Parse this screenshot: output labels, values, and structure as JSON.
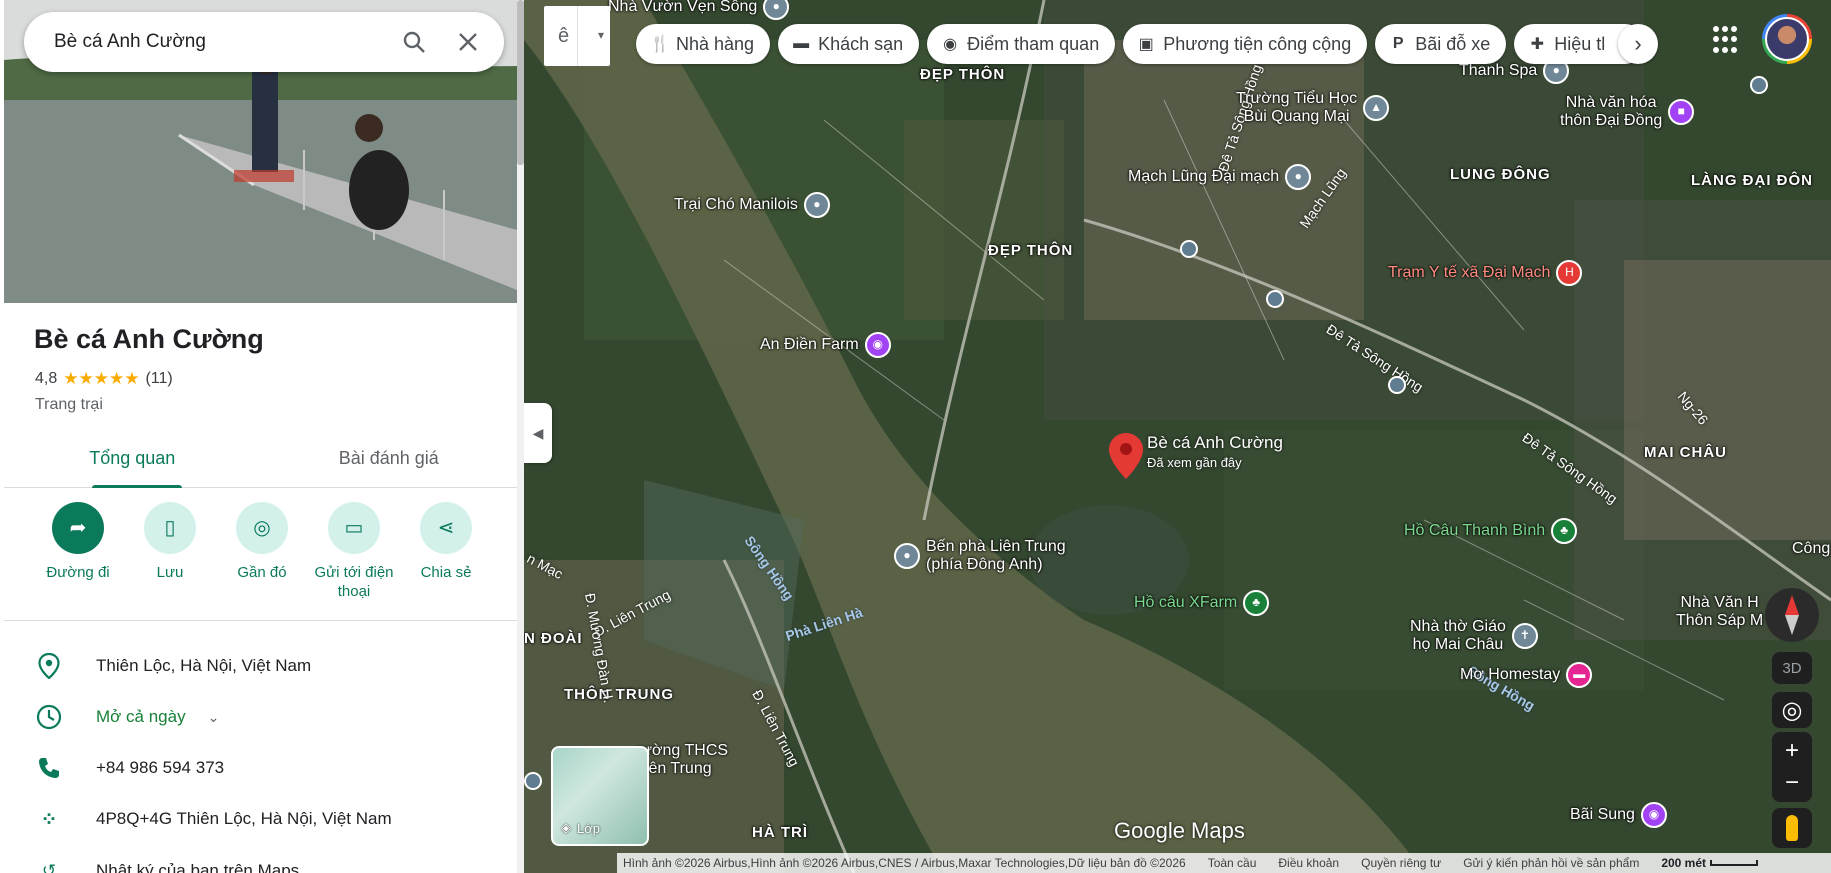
{
  "search": {
    "query": "Bè cá Anh Cường"
  },
  "place": {
    "name": "Bè cá Anh Cường",
    "rating": "4,8",
    "stars": "★★★★★",
    "review_count": "(11)",
    "category": "Trang trại"
  },
  "tabs": [
    {
      "label": "Tổng quan",
      "active": true
    },
    {
      "label": "Bài đánh giá",
      "active": false
    }
  ],
  "actions": [
    {
      "label": "Đường đi",
      "icon": "directions-icon"
    },
    {
      "label": "Lưu",
      "icon": "bookmark-icon"
    },
    {
      "label": "Gần đó",
      "icon": "nearby-icon"
    },
    {
      "label": "Gửi tới điện thoại",
      "icon": "send-to-phone-icon"
    },
    {
      "label": "Chia sẻ",
      "icon": "share-icon"
    }
  ],
  "info": {
    "address": "Thiên Lộc, Hà Nội, Việt Nam",
    "hours": "Mở cả ngày",
    "phone": "+84 986 594 373",
    "plus_code": "4P8Q+4G Thiên Lộc, Hà Nội, Việt Nam",
    "history": "Nhật ký của bạn trên Maps"
  },
  "top_bar": {
    "lang_button": "ê",
    "chips": [
      {
        "label": "Nhà hàng",
        "icon": "restaurant-icon"
      },
      {
        "label": "Khách sạn",
        "icon": "hotel-icon"
      },
      {
        "label": "Điểm tham quan",
        "icon": "camera-icon"
      },
      {
        "label": "Phương tiện công cộng",
        "icon": "transit-icon"
      },
      {
        "label": "Bãi đỗ xe",
        "icon": "parking-icon"
      },
      {
        "label": "Hiệu tl",
        "icon": "pharmacy-icon"
      }
    ]
  },
  "map": {
    "marker": {
      "title": "Bè cá Anh Cường",
      "subtitle": "Đã xem gần đây"
    },
    "pois": [
      {
        "id": "nha-vuon",
        "label": "Nhà Vườn Vẹn Sông"
      },
      {
        "id": "truong-tieu-hoc",
        "label": "Trường Tiểu Học\nBùi Quang Mại"
      },
      {
        "id": "thanh-spa",
        "label": "Thanh Spa"
      },
      {
        "id": "nha-van-hoa-dai-dong",
        "label": "Nhà văn hóa\nthôn Đại Đồng"
      },
      {
        "id": "mach-lung",
        "label": "Mạch Lũng Đại mạch"
      },
      {
        "id": "trai-cho",
        "label": "Trại Chó Manilois"
      },
      {
        "id": "tram-y-te",
        "label": "Trạm Y tế xã Đại Mạch"
      },
      {
        "id": "an-dien-farm",
        "label": "An Điền Farm"
      },
      {
        "id": "ho-cau-thanh-binh",
        "label": "Hồ Câu Thanh Bình"
      },
      {
        "id": "ben-pha",
        "label": "Bến phà Liên Trung\n(phía Đông Anh)"
      },
      {
        "id": "ho-cau-xfarm",
        "label": "Hồ câu XFarm"
      },
      {
        "id": "nha-tho",
        "label": "Nhà thờ Giáo\nhọ Mai Châu"
      },
      {
        "id": "nha-van-thon-sap",
        "label": "Nhà Văn H\nThôn Sáp M"
      },
      {
        "id": "mo-homestay",
        "label": "Mơ Homestay"
      },
      {
        "id": "truong-thcs",
        "label": "rường THCS\nLiên Trung"
      },
      {
        "id": "bai-sung",
        "label": "Bãi Sung"
      },
      {
        "id": "cong",
        "label": "Công"
      }
    ],
    "areas": [
      {
        "id": "dep-thon-1",
        "label": "ĐẸP THÔN"
      },
      {
        "id": "dep-thon-2",
        "label": "ĐẸP THÔN"
      },
      {
        "id": "lung-dong",
        "label": "LUNG ĐÔNG"
      },
      {
        "id": "lang-dai-don",
        "label": "LÀNG ĐẠI ĐÔN"
      },
      {
        "id": "mai-chau",
        "label": "MAI CHÂU"
      },
      {
        "id": "doai",
        "label": "N ĐOÀI"
      },
      {
        "id": "thon-trung",
        "label": "THÔN TRUNG"
      },
      {
        "id": "ha-tri",
        "label": "HÀ TRÌ"
      }
    ],
    "roads": [
      {
        "id": "de-ta-song-hong-1",
        "label": "Đê Tả Sông Hồng"
      },
      {
        "id": "de-ta-song-hong-2",
        "label": "Đê Tả Sông Hồng"
      },
      {
        "id": "de-ta-song-hong-3",
        "label": "Đê Tả Sông Hồng"
      },
      {
        "id": "mach-lung-road",
        "label": "Mạch Lũng"
      },
      {
        "id": "ng26",
        "label": "Ng-26"
      },
      {
        "id": "lien-trung-1",
        "label": "Đ. Liên Trung"
      },
      {
        "id": "lien-trung-2",
        "label": "Đ. Liên Trung"
      },
      {
        "id": "muong-danh",
        "label": "Đ. Mương Đàn H."
      },
      {
        "id": "mac",
        "label": "n Mạc"
      }
    ],
    "rivers": [
      {
        "id": "song-hong",
        "label": "Sông Hồng"
      },
      {
        "id": "pha-lien-ha",
        "label": "Phà Liên Hà"
      },
      {
        "id": "song-hong-2",
        "label": "Sông Hồng"
      }
    ],
    "layers_label": "Lớp",
    "three_d": "3D",
    "logo": "Google Maps"
  },
  "attribution": {
    "imagery": "Hình ảnh ©2026 Airbus,Hình ảnh ©2026 Airbus,CNES / Airbus,Maxar Technologies,Dữ liệu bản đồ ©2026",
    "links": [
      "Toàn cầu",
      "Điều khoản",
      "Quyền riêng tư",
      "Gửi ý kiến phản hồi về sản phẩm"
    ],
    "scale": "200 mét"
  },
  "colors": {
    "accent": "#0b7a5b",
    "star": "#f9ab00",
    "marker": "#e53935"
  }
}
